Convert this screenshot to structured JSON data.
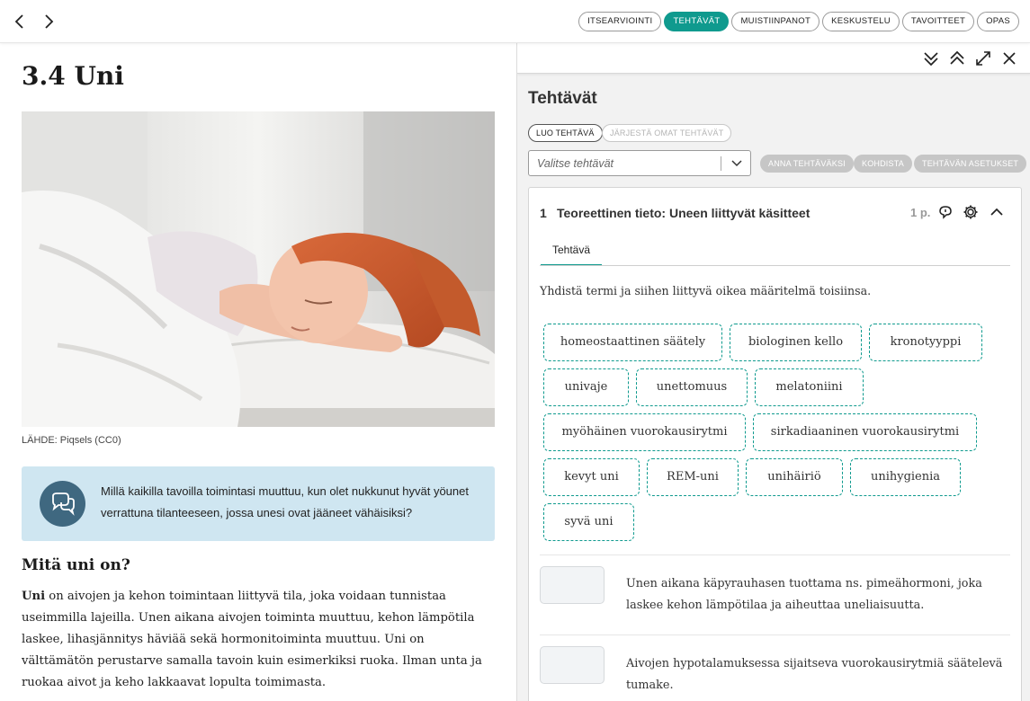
{
  "topbar": {
    "back_icon": "chevron-left-icon",
    "forward_icon": "chevron-right-icon",
    "tabs": [
      {
        "label": "ITSEARVIOINTI",
        "active": false
      },
      {
        "label": "TEHTÄVÄT",
        "active": true
      },
      {
        "label": "MUISTIINPANOT",
        "active": false
      },
      {
        "label": "KESKUSTELU",
        "active": false
      },
      {
        "label": "TAVOITTEET",
        "active": false
      },
      {
        "label": "OPAS",
        "active": false
      }
    ],
    "accent_color": "#0f9a8e"
  },
  "article": {
    "title": "3.4 Uni",
    "image_caption": "LÄHDE: Piqsels (CC0)",
    "callout_text": "Millä kaikilla tavoilla toimintasi muuttuu, kun olet nukkunut hyvät yöunet verrattuna tilanteeseen, jossa unesi ovat jääneet vähäisiksi?",
    "section_heading": "Mitä uni on?",
    "body_bold": "Uni",
    "body_text": " on aivojen ja kehon toimintaan liittyvä tila, joka voidaan tunnistaa useimmilla lajeilla. Unen aikana aivojen toiminta muuttuu, kehon lämpötila laskee, lihasjännitys häviää sekä hormonitoiminta muuttuu. Uni on välttämätön perustarve samalla tavoin kuin esimerkiksi ruoka. Ilman unta ja ruokaa aivot ja keho lakkaavat lopulta toimimasta."
  },
  "panel": {
    "heading": "Tehtävät",
    "create_task": "LUO TEHTÄVÄ",
    "order_tasks": "JÄRJESTÄ OMAT TEHTÄVÄT",
    "select_placeholder": "Valitse tehtävät",
    "assign": "ANNA TEHTÄVÄKSI",
    "target": "KOHDISTA",
    "task_settings": "TEHTÄVÄN ASETUKSET",
    "task": {
      "number": "1",
      "title": "Teoreettinen tieto: Uneen liittyvät käsitteet",
      "points": "1 p.",
      "tab": "Tehtävä",
      "instruction": "Yhdistä termi ja siihen liittyvä oikea määritelmä toisiinsa.",
      "terms": [
        "homeostaattinen säätely",
        "biologinen kello",
        "kronotyyppi",
        "univaje",
        "unettomuus",
        "melatoniini",
        "myöhäinen vuorokausirytmi",
        "sirkadiaaninen vuorokausirytmi",
        "kevyt uni",
        "REM-uni",
        "unihäiriö",
        "unihygienia",
        "syvä uni"
      ],
      "definitions": [
        "Unen aikana käpyrauhasen tuottama ns. pimeähormoni, joka laskee kehon lämpötilaa ja aiheuttaa uneliaisuutta.",
        "Aivojen hypotalamuksessa sijaitseva vuorokausirytmiä säätelevä tumake."
      ]
    }
  }
}
